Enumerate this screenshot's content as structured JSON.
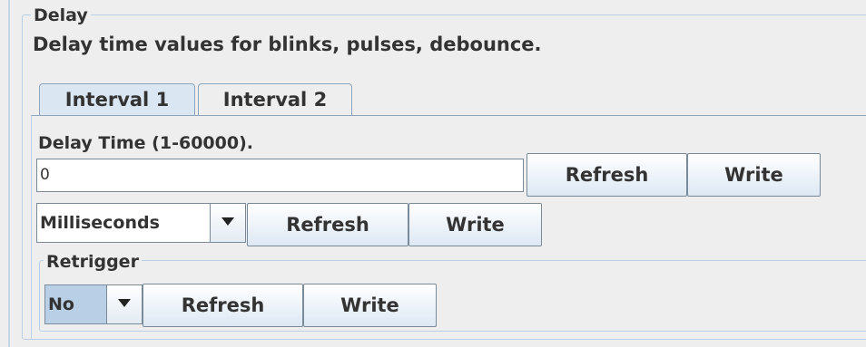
{
  "delay": {
    "legend": "Delay",
    "description": "Delay time values for blinks, pulses, debounce.",
    "tabs": [
      {
        "label": "Interval 1",
        "active": true
      },
      {
        "label": "Interval 2",
        "active": false
      }
    ],
    "delay_time": {
      "label": "Delay Time (1-60000).",
      "value": "0",
      "refresh_label": "Refresh",
      "write_label": "Write"
    },
    "units": {
      "selected": "Milliseconds",
      "refresh_label": "Refresh",
      "write_label": "Write"
    },
    "retrigger": {
      "legend": "Retrigger",
      "selected": "No",
      "refresh_label": "Refresh",
      "write_label": "Write"
    }
  },
  "colors": {
    "background": "#eeeeee",
    "active_tab": "#dae6f2",
    "selected_combo": "#b8cfe5",
    "border": "#b8cfe5"
  }
}
